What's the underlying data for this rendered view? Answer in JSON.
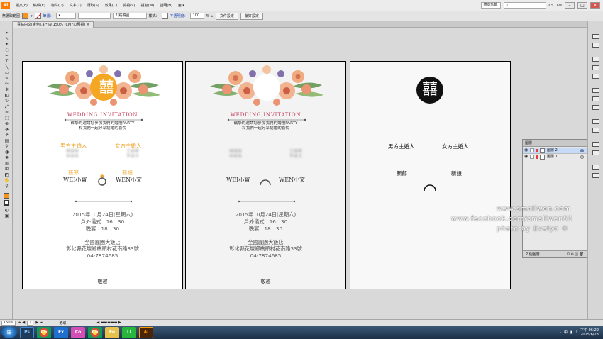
{
  "menu": {
    "items": [
      "檔案(F)",
      "編輯(E)",
      "物件(O)",
      "文字(T)",
      "選取(S)",
      "效果(C)",
      "檢視(V)",
      "視窗(W)",
      "說明(H)"
    ],
    "workspace": "基本功能",
    "search_placeholder": "",
    "cslive": "CS Live"
  },
  "control": {
    "selection_label": "無選取範圍",
    "stroke_label": "筆畫：",
    "stroke_points": "2 點橢圓",
    "style_label": "樣式：",
    "opacity_label": "不透明度：",
    "opacity_value": "100",
    "opacity_unit": "%",
    "doc_setup": "文件設定",
    "preferences": "偏好設定",
    "fill_color": "#f7941d"
  },
  "document": {
    "tab_title": "喜帖內文(金色).ai* @ 150% (CMYK/預視)"
  },
  "invite": {
    "emblem": "囍",
    "title": "WEDDING INVITATION",
    "intro_line1": "誠摯的邀請您參加我們的婚禮PARTY",
    "intro_line2": "和我們一起分享結婚的喜悅",
    "groom_host": "男方主婚人",
    "bride_host": "女方主婚人",
    "groom_host_names": [
      "陳國雄",
      "林美珠"
    ],
    "bride_host_names": [
      "王國華",
      "李美玉"
    ],
    "groom_label": "新郎",
    "bride_label": "新娘",
    "groom_name": "WEI小寶",
    "bride_name": "WEN小文",
    "date": "2015年10月24日(星期六)",
    "ceremony": "戶外儀式　16：30",
    "banquet": "晚宴　18：30",
    "venue": "全國麗園大飯店",
    "address": "彰化縣花壇鄉橋頭村花南路33號",
    "phone": "04-7874685",
    "footer": "敬邀",
    "accent_color": "#f0a52a",
    "title_color": "#c23a5a"
  },
  "layers_panel": {
    "title": "圖層",
    "layers": [
      {
        "name": "圖層 2",
        "color": "#e24040",
        "selected": true
      },
      {
        "name": "圖層 1",
        "color": "#e24040",
        "selected": false
      }
    ],
    "count": "2 個圖層"
  },
  "watermark": {
    "line1": "www.smallwen.com",
    "line2": "www.facebook.com/smallwen53",
    "line3": "photo by Evelyn ®"
  },
  "statusbar": {
    "zoom": "150%",
    "page": "1",
    "mode": "選取"
  },
  "taskbar": {
    "apps": [
      "Ps",
      "Ch",
      "Ex",
      "Co",
      "Ch",
      "Fo",
      "LI",
      "Ai"
    ],
    "lang": "中",
    "time": "下午 06:22",
    "date": "2015/6/28"
  }
}
